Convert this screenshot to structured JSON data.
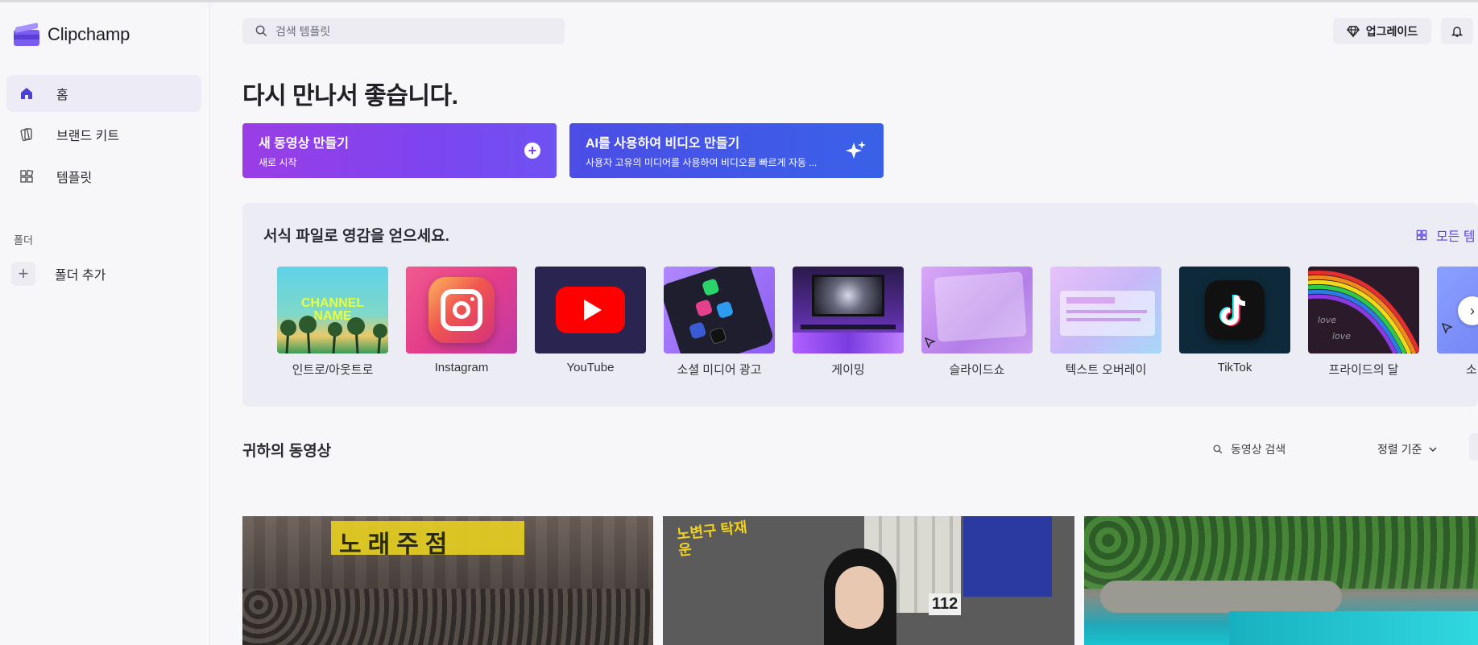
{
  "app": {
    "name": "Clipchamp"
  },
  "colors": {
    "accent": "#5b46e0",
    "cta_purple": "#8b3ee8",
    "cta_blue": "#4458e8"
  },
  "sidebar": {
    "items": [
      {
        "label": "홈",
        "icon": "home-icon",
        "active": true
      },
      {
        "label": "브랜드 키트",
        "icon": "brand-kit-icon",
        "active": false
      },
      {
        "label": "템플릿",
        "icon": "templates-icon",
        "active": false
      }
    ],
    "folders_label": "폴더",
    "add_folder_label": "폴더 추가"
  },
  "header": {
    "search_placeholder": "검색 템플릿",
    "upgrade_label": "업그레이드"
  },
  "greeting": "다시 만나서 좋습니다.",
  "cta": {
    "new_video": {
      "title": "새 동영상 만들기",
      "subtitle": "새로 시작"
    },
    "ai_video": {
      "title": "AI를 사용하여 비디오 만들기",
      "subtitle": "사용자 고유의 미디어를 사용하여 비디오를 빠르게 자동 ..."
    }
  },
  "templates": {
    "title": "서식 파일로 영감을 얻으세요.",
    "all_link": "모든 템",
    "items": [
      {
        "label": "인트로/아웃트로",
        "thumb_text": "CHANNEL NAME"
      },
      {
        "label": "Instagram"
      },
      {
        "label": "YouTube"
      },
      {
        "label": "소셜 미디어 광고"
      },
      {
        "label": "게이밍"
      },
      {
        "label": "슬라이드쇼"
      },
      {
        "label": "텍스트 오버레이"
      },
      {
        "label": "TikTok"
      },
      {
        "label": "프라이드의 달"
      },
      {
        "label": "소"
      }
    ]
  },
  "videos": {
    "title": "귀하의 동영상",
    "search_placeholder": "동영상 검색",
    "sort_label": "정렬 기준",
    "items": [
      {
        "thumb_text": "노래주점"
      },
      {
        "thumb_text": "노변구 탁재운",
        "badge": "112"
      },
      {
        "thumb_text": ""
      }
    ]
  }
}
